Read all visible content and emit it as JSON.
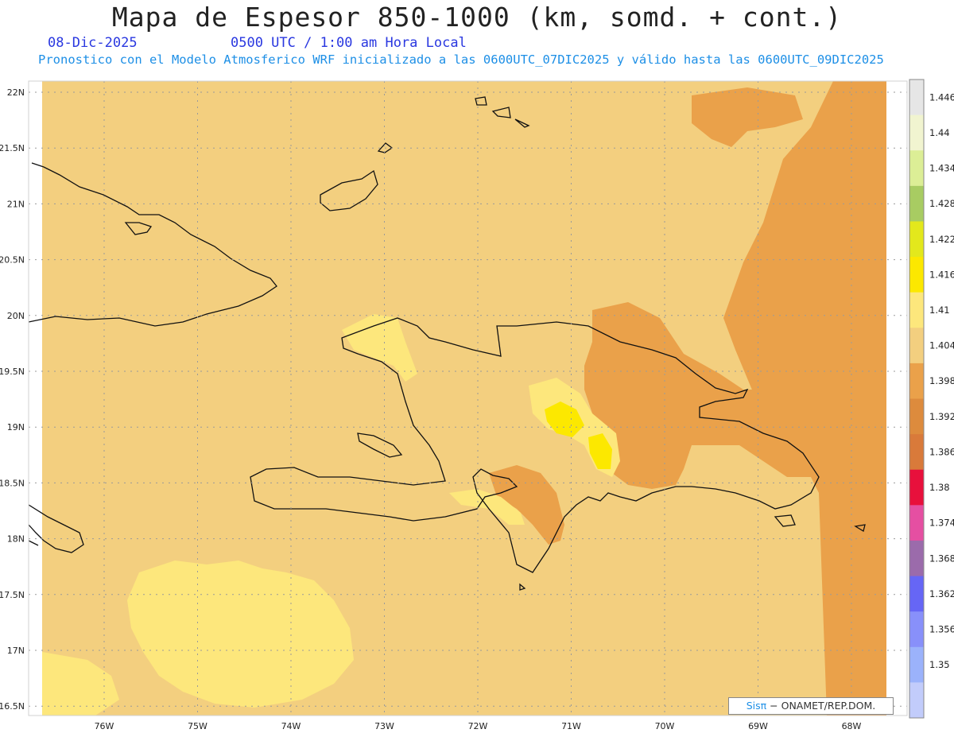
{
  "header": {
    "title": "Mapa de Espesor 850-1000 (km, somd. + cont.)",
    "date": "08-Dic-2025",
    "time": "0500 UTC / 1:00 am Hora Local",
    "forecast": "Pronostico con el Modelo Atmosferico WRF inicializado a las 0600UTC_07DIC2025 y válido hasta las  0600UTC_09DIC2025"
  },
  "axes": {
    "lat_labels": [
      "22N",
      "21.5N",
      "21N",
      "20.5N",
      "20N",
      "19.5N",
      "19N",
      "18.5N",
      "18N",
      "17.5N",
      "17N",
      "16.5N"
    ],
    "lon_labels": [
      "76W",
      "75W",
      "74W",
      "73W",
      "72W",
      "71W",
      "70W",
      "69W",
      "68W"
    ]
  },
  "colorbar": {
    "levels": [
      "1.446",
      "1.44",
      "1.434",
      "1.428",
      "1.422",
      "1.416",
      "1.41",
      "1.404",
      "1.398",
      "1.392",
      "1.386",
      "1.38",
      "1.374",
      "1.368",
      "1.362",
      "1.356",
      "1.35"
    ],
    "colors": [
      "#e6e6e6",
      "#f1f4d0",
      "#dcee96",
      "#a8cc62",
      "#e3e81c",
      "#fce800",
      "#fde77c",
      "#f3cf7f",
      "#eaa14a",
      "#dd8b3d",
      "#d97a3a",
      "#e8103c",
      "#e54fa2",
      "#9b6bab",
      "#6666f5",
      "#8890fa",
      "#9bb2fb",
      "#c2ccfb"
    ]
  },
  "map_colors": {
    "background": "#f3cf7f",
    "mid": "#eaa14a",
    "low": "#dd8b3d",
    "high": "#fde77c",
    "peak": "#fce800",
    "coast": "#111111"
  },
  "footer": {
    "credit_sis": "Sisπ",
    "credit_rest": "− ONAMET/REP.DOM."
  }
}
